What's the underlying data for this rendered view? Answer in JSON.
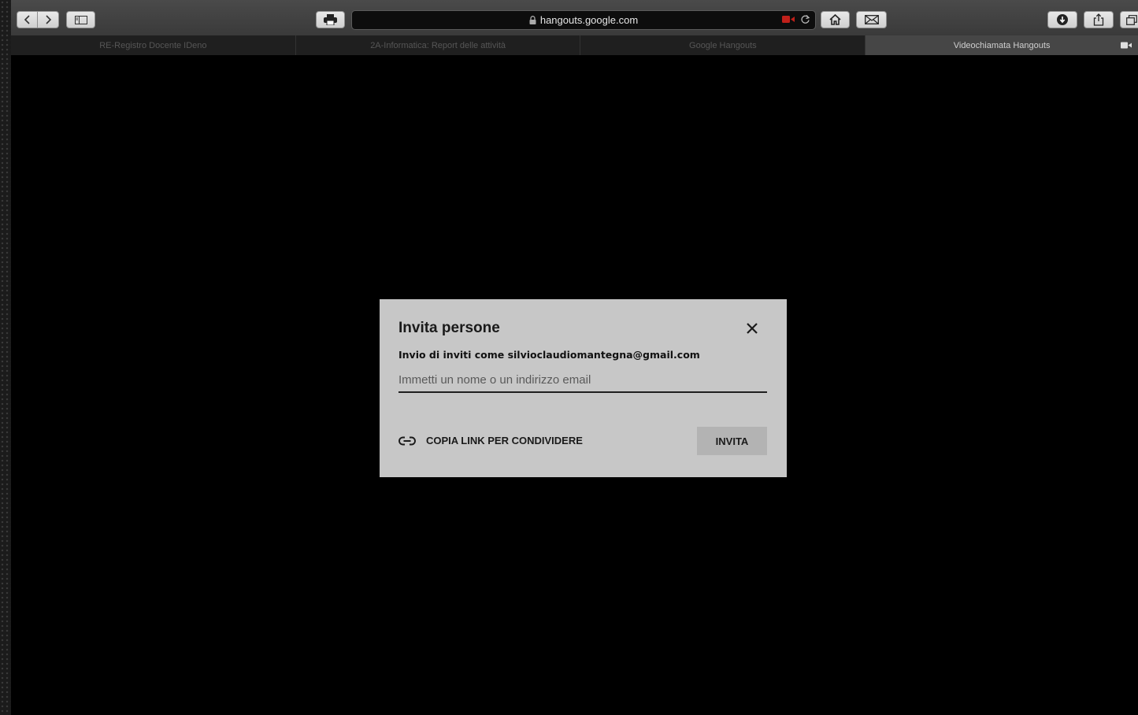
{
  "browser": {
    "url": "hangouts.google.com",
    "tabs": [
      {
        "label": "RE-Registro Docente IDeno",
        "active": false
      },
      {
        "label": "2A-Informatica: Report delle attività",
        "active": false
      },
      {
        "label": "Google Hangouts",
        "active": false
      },
      {
        "label": "Videochiamata Hangouts",
        "active": true
      }
    ],
    "icons": [
      "back-icon",
      "forward-icon",
      "sidebar-icon",
      "printer-icon",
      "lock-icon",
      "camera-icon",
      "reload-icon",
      "home-icon",
      "mail-icon",
      "download-icon",
      "share-icon",
      "tabs-icon"
    ]
  },
  "dialog": {
    "title": "Invita persone",
    "subtitle": "Invio di inviti come silvioclaudiomantegna@gmail.com",
    "input_placeholder": "Immetti un nome o un indirizzo email",
    "input_value": "",
    "copy_link_label": "COPIA LINK PER CONDIVIDERE",
    "invite_label": "INVITA"
  }
}
